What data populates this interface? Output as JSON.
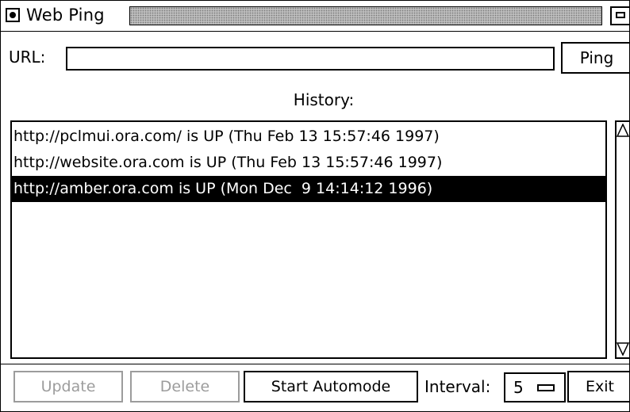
{
  "window": {
    "title": "Web Ping"
  },
  "url_row": {
    "label": "URL:",
    "value": "",
    "ping_button": "Ping"
  },
  "history": {
    "label": "History:",
    "items": [
      "http://pclmui.ora.com/ is UP (Thu Feb 13 15:57:46 1997)",
      "http://website.ora.com is UP (Thu Feb 13 15:57:46 1997)",
      "http://amber.ora.com is UP (Mon Dec  9 14:14:12 1996)"
    ],
    "selected_index": 2
  },
  "buttons": {
    "update": "Update",
    "delete": "Delete",
    "automode": "Start Automode",
    "interval_label": "Interval:",
    "interval_value": "5",
    "exit": "Exit"
  },
  "icons": {
    "close": "close-icon",
    "maximize": "maximize-icon",
    "scroll_up": "scroll-up-arrow-icon",
    "scroll_down": "scroll-down-arrow-icon",
    "menu": "option-menu-indicator-icon"
  },
  "colors": {
    "background": "#ffffff",
    "foreground": "#000000",
    "disabled": "#9c9c9c",
    "selection": "#000000",
    "title_stripe": "#bdbdbd"
  }
}
